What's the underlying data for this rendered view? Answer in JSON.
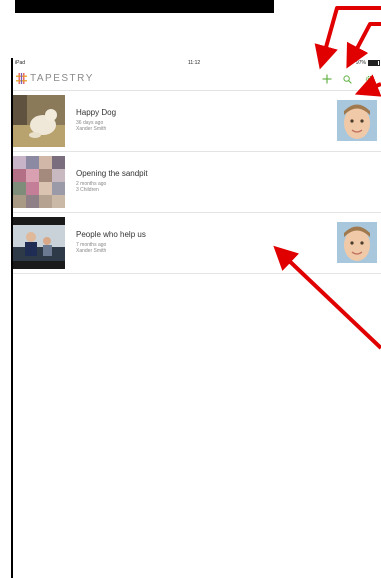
{
  "status_bar": {
    "carrier": "iPad",
    "time": "11:12",
    "battery": "97%"
  },
  "app": {
    "name": "TAPESTRY",
    "icons": {
      "logo": "tapestry-grid-icon",
      "add": "plus-icon",
      "search": "search-icon",
      "settings": "gear-icon"
    },
    "colors": {
      "accent": "#62b345",
      "logo_grid": "#e35252"
    }
  },
  "observations": [
    {
      "title": "Happy Dog",
      "time": "36 days ago",
      "subtitle": "Xander Smith",
      "has_avatar": true
    },
    {
      "title": "Opening the sandpit",
      "time": "2 months ago",
      "subtitle": "3 Children",
      "has_avatar": false
    },
    {
      "title": "People who help us",
      "time": "7 months ago",
      "subtitle": "Xander Smith",
      "has_avatar": true
    }
  ],
  "annotation_color": "#e00000"
}
